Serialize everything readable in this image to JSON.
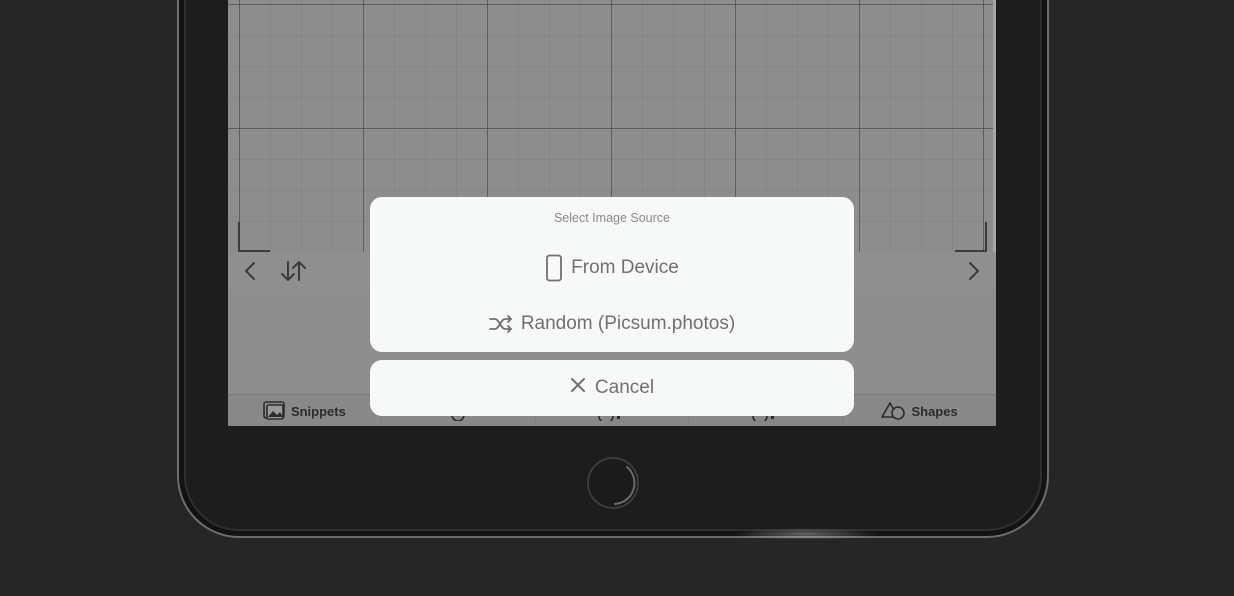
{
  "action_sheet": {
    "title": "Select Image Source",
    "options": [
      {
        "label": "From Device",
        "icon": "phone-icon"
      },
      {
        "label": "Random (Picsum.photos)",
        "icon": "shuffle-icon"
      }
    ],
    "cancel": {
      "label": "Cancel",
      "icon": "close-icon"
    }
  },
  "tabbar": {
    "snippets_label": "Snippets",
    "shapes_label": "Shapes"
  },
  "colors": {
    "sheet_bg": "#f7f8f8",
    "sheet_text": "#707070",
    "dim_overlay": "#8e8e8e",
    "device_frame": "#1d1d1d"
  }
}
